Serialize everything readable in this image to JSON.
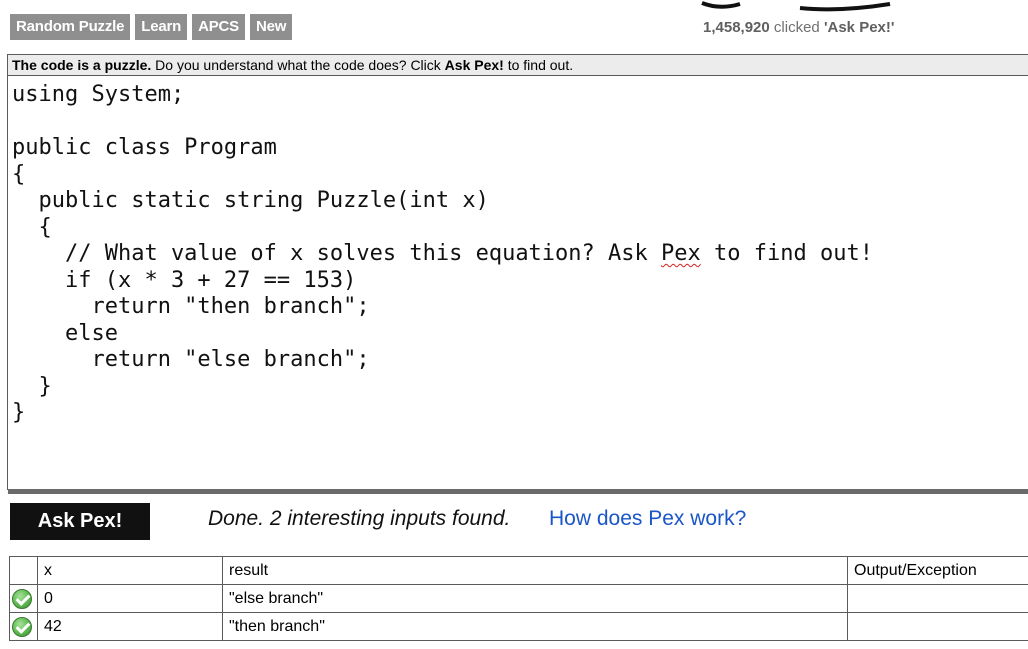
{
  "nav": {
    "items": [
      "Random Puzzle",
      "Learn",
      "APCS",
      "New"
    ]
  },
  "counter": {
    "count": "1,458,920",
    "text": "clicked",
    "action": "'Ask Pex!'"
  },
  "editor": {
    "bar_bold": "The code is a puzzle.",
    "bar_text": "Do you understand what the code does? Click",
    "bar_action": "Ask Pex!",
    "bar_tail": "to find out.",
    "code_lines": [
      "using System;",
      "",
      "public class Program",
      "{",
      "  public static string Puzzle(int x)",
      "  {",
      "    // What value of x solves this equation? Ask ",
      "    if (x * 3 + 27 == 153)",
      "      return \"then branch\";",
      "    else",
      "      return \"else branch\";",
      "  }",
      "}"
    ],
    "comment_word": "Pex",
    "comment_tail": " to find out!"
  },
  "ask": {
    "button_label": "Ask Pex!",
    "status": "Done. 2 interesting inputs found.",
    "link": "How does Pex work?"
  },
  "results": {
    "headers": [
      "",
      "x",
      "result",
      "Output/Exception"
    ],
    "rows": [
      {
        "status_icon": "check-icon",
        "x": "0",
        "result": "\"else branch\"",
        "output": ""
      },
      {
        "status_icon": "check-icon",
        "x": "42",
        "result": "\"then branch\"",
        "output": ""
      }
    ]
  }
}
